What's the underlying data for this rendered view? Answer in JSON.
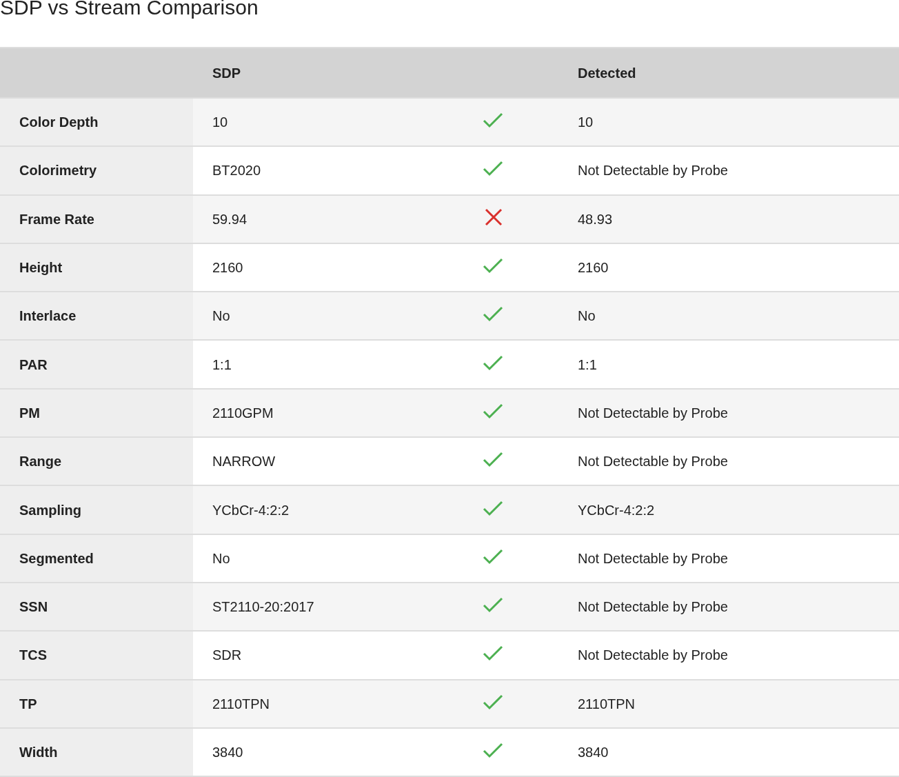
{
  "title": "SDP vs Stream Comparison",
  "columns": [
    "SDP",
    "Detected"
  ],
  "rows": [
    {
      "property": "Color Depth",
      "sdp": "10",
      "match": true,
      "detected": "10"
    },
    {
      "property": "Colorimetry",
      "sdp": "BT2020",
      "match": true,
      "detected": "Not Detectable by Probe"
    },
    {
      "property": "Frame Rate",
      "sdp": "59.94",
      "match": false,
      "detected": "48.93"
    },
    {
      "property": "Height",
      "sdp": "2160",
      "match": true,
      "detected": "2160"
    },
    {
      "property": "Interlace",
      "sdp": "No",
      "match": true,
      "detected": "No"
    },
    {
      "property": "PAR",
      "sdp": "1:1",
      "match": true,
      "detected": "1:1"
    },
    {
      "property": "PM",
      "sdp": "2110GPM",
      "match": true,
      "detected": "Not Detectable by Probe"
    },
    {
      "property": "Range",
      "sdp": "NARROW",
      "match": true,
      "detected": "Not Detectable by Probe"
    },
    {
      "property": "Sampling",
      "sdp": "YCbCr-4:2:2",
      "match": true,
      "detected": "YCbCr-4:2:2"
    },
    {
      "property": "Segmented",
      "sdp": "No",
      "match": true,
      "detected": "Not Detectable by Probe"
    },
    {
      "property": "SSN",
      "sdp": "ST2110-20:2017",
      "match": true,
      "detected": "Not Detectable by Probe"
    },
    {
      "property": "TCS",
      "sdp": "SDR",
      "match": true,
      "detected": "Not Detectable by Probe"
    },
    {
      "property": "TP",
      "sdp": "2110TPN",
      "match": true,
      "detected": "2110TPN"
    },
    {
      "property": "Width",
      "sdp": "3840",
      "match": true,
      "detected": "3840"
    }
  ]
}
